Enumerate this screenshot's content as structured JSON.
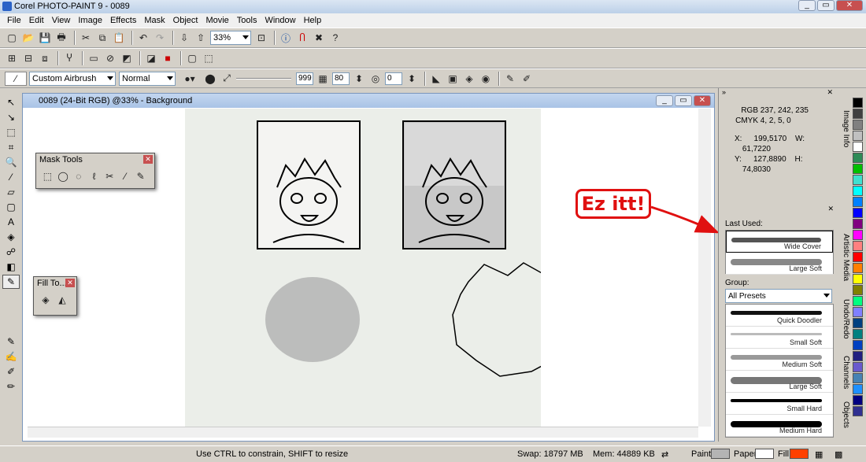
{
  "window": {
    "title": "Corel PHOTO-PAINT 9 - 0089"
  },
  "menu": [
    "File",
    "Edit",
    "View",
    "Image",
    "Effects",
    "Mask",
    "Object",
    "Movie",
    "Tools",
    "Window",
    "Help"
  ],
  "toolbar": {
    "zoom": "33%"
  },
  "propbar": {
    "brush": "Custom Airbrush",
    "mode": "Normal",
    "size": "999",
    "transparency": "80",
    "soft": "0"
  },
  "document": {
    "title": "0089 (24-Bit RGB) @33% - Background"
  },
  "mask_tools": {
    "title": "Mask Tools"
  },
  "fill_tools": {
    "title": "Fill To..."
  },
  "callout": {
    "text": "Ez itt!"
  },
  "info": {
    "rgb_label": "RGB",
    "rgb": "237, 242, 235",
    "cmyk_label": "CMYK",
    "cmyk": "4, 2, 5, 0",
    "x_label": "X:",
    "x": "199,5170",
    "y_label": "Y:",
    "y": "127,8890",
    "w_label": "W:",
    "w": "61,7220",
    "h_label": "H:",
    "h": "74,8030"
  },
  "media": {
    "last_used_label": "Last Used:",
    "last_used": [
      "Wide Cover",
      "Large Soft"
    ],
    "group_label": "Group:",
    "group_value": "All Presets",
    "presets": [
      "Quick Doodler",
      "Small Soft",
      "Medium Soft",
      "Large Soft",
      "Small Hard",
      "Medium Hard"
    ]
  },
  "side_tabs": [
    "Image Info",
    "Artistic Media",
    "Undo/Redo",
    "Channels",
    "Objects"
  ],
  "palette": [
    "#000000",
    "#404040",
    "#808080",
    "#c0c0c0",
    "#ffffff",
    "#2e8b57",
    "#00c000",
    "#40e0d0",
    "#00ffff",
    "#0080ff",
    "#0000ff",
    "#800080",
    "#ff00ff",
    "#ff8080",
    "#ff0000",
    "#ff8000",
    "#ffff00",
    "#808000",
    "#00ff80",
    "#8080ff",
    "#004080",
    "#008080",
    "#0040c0",
    "#202080",
    "#6a5acd",
    "#4682b4",
    "#1e90ff",
    "#000080",
    "#303090"
  ],
  "status": {
    "hint": "Use CTRL to constrain, SHIFT to resize",
    "swap": "Swap: 18797 MB",
    "mem": "Mem: 44889 KB",
    "paint_label": "Paint:",
    "paint_color": "#b4b4b4",
    "paper_label": "Paper:",
    "paper_color": "#ffffff",
    "fill_label": "Fill:",
    "fill_color": "#ff4000"
  }
}
